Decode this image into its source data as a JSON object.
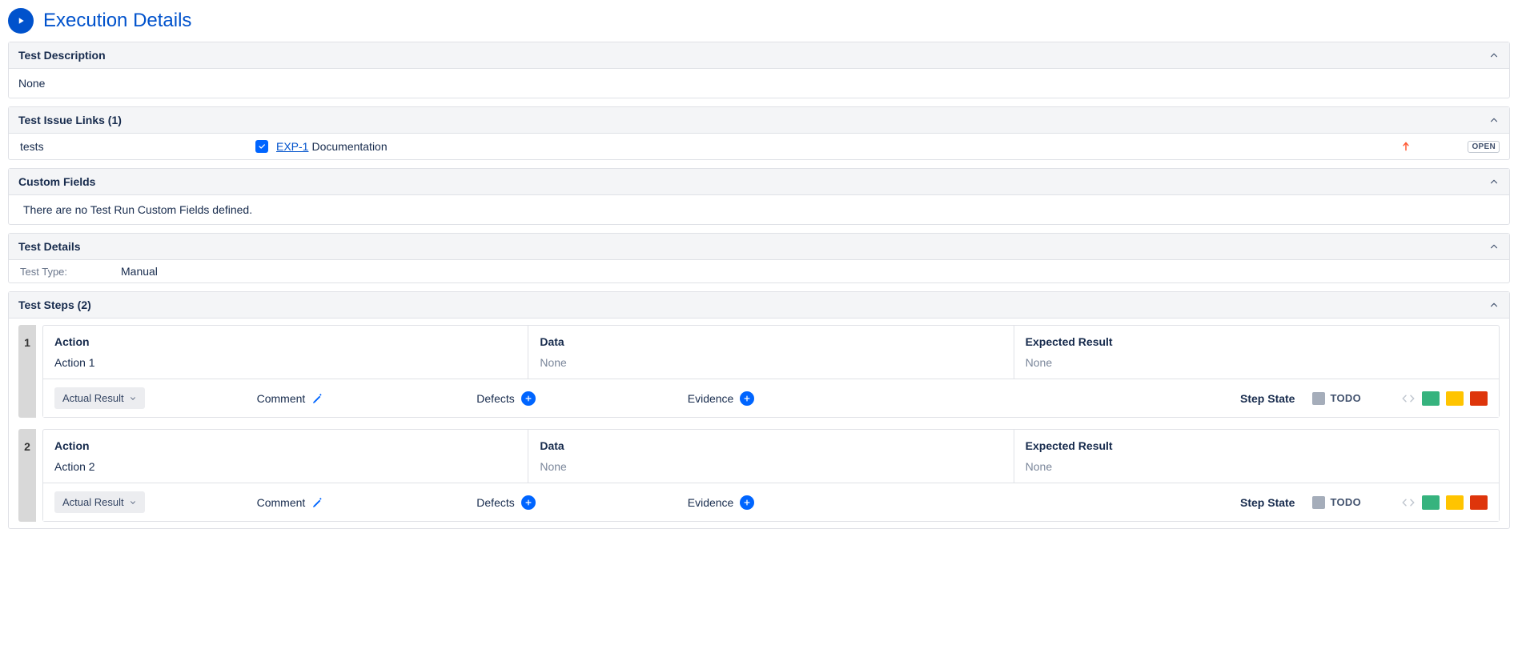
{
  "page_title": "Execution Details",
  "panels": {
    "test_description": {
      "title": "Test Description",
      "value": "None"
    },
    "issue_links": {
      "title": "Test Issue Links (1)",
      "rel": "tests",
      "key": "EXP-1",
      "summary": "Documentation",
      "status": "OPEN"
    },
    "custom_fields": {
      "title": "Custom Fields",
      "value": "There are no Test Run Custom Fields defined."
    },
    "test_details": {
      "title": "Test Details",
      "type_label": "Test Type:",
      "type_value": "Manual"
    },
    "test_steps": {
      "title": "Test Steps (2)"
    }
  },
  "step_labels": {
    "action": "Action",
    "data": "Data",
    "expected": "Expected Result",
    "actual_result": "Actual Result",
    "comment": "Comment",
    "defects": "Defects",
    "evidence": "Evidence",
    "step_state": "Step State"
  },
  "steps": [
    {
      "num": "1",
      "action": "Action 1",
      "data": "None",
      "expected": "None",
      "state": "TODO"
    },
    {
      "num": "2",
      "action": "Action 2",
      "data": "None",
      "expected": "None",
      "state": "TODO"
    }
  ],
  "colors": {
    "state_todo": "#a5adba",
    "pass": "#36b37e",
    "executing": "#ffc400",
    "fail": "#de350b"
  }
}
